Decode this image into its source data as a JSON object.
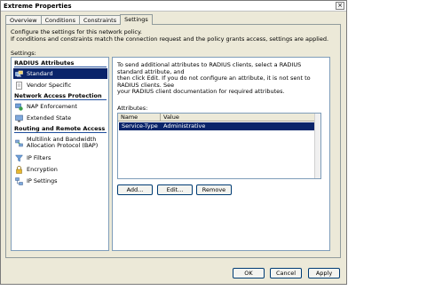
{
  "window": {
    "title": "Extreme Properties",
    "close_glyph": "×"
  },
  "tabs": [
    {
      "label": "Overview"
    },
    {
      "label": "Conditions"
    },
    {
      "label": "Constraints"
    },
    {
      "label": "Settings",
      "active": true
    }
  ],
  "description": {
    "line1": "Configure the settings for this network policy.",
    "line2": "If conditions and constraints match the connection request and the policy grants access, settings are applied."
  },
  "settings_label": "Settings:",
  "nav": {
    "sections": [
      {
        "title": "RADIUS Attributes"
      },
      {
        "title": "Network Access Protection"
      },
      {
        "title": "Routing and Remote Access"
      }
    ],
    "items": [
      {
        "label": "Standard",
        "icon": "radius-icon",
        "selected": true
      },
      {
        "label": "Vendor Specific",
        "icon": "document-icon"
      },
      {
        "label": "NAP Enforcement",
        "icon": "nap-icon"
      },
      {
        "label": "Extended State",
        "icon": "monitor-icon"
      },
      {
        "label_line1": "Multilink and Bandwidth",
        "label_line2": "Allocation Protocol (BAP)",
        "icon": "multilink-icon"
      },
      {
        "label": "IP Filters",
        "icon": "filter-icon"
      },
      {
        "label": "Encryption",
        "icon": "lock-icon"
      },
      {
        "label": "IP Settings",
        "icon": "network-icon"
      }
    ]
  },
  "content": {
    "desc_line1": "To send additional attributes to RADIUS clients, select a RADIUS standard attribute, and",
    "desc_line2": "then click Edit. If you do not configure an attribute, it is not sent to RADIUS clients. See",
    "desc_line3": "your RADIUS client documentation for required attributes.",
    "attributes_label": "Attributes:",
    "table": {
      "columns": [
        "Name",
        "Value"
      ],
      "rows": [
        {
          "name": "Service-Type",
          "value": "Administrative"
        }
      ]
    },
    "buttons": {
      "add": "Add...",
      "edit": "Edit...",
      "remove": "Remove"
    }
  },
  "footer": {
    "ok": "OK",
    "cancel": "Cancel",
    "apply": "Apply"
  },
  "colors": {
    "selection": "#0a246a",
    "section_rule": "#1f4e9c",
    "dialog_bg": "#ece9d8"
  }
}
